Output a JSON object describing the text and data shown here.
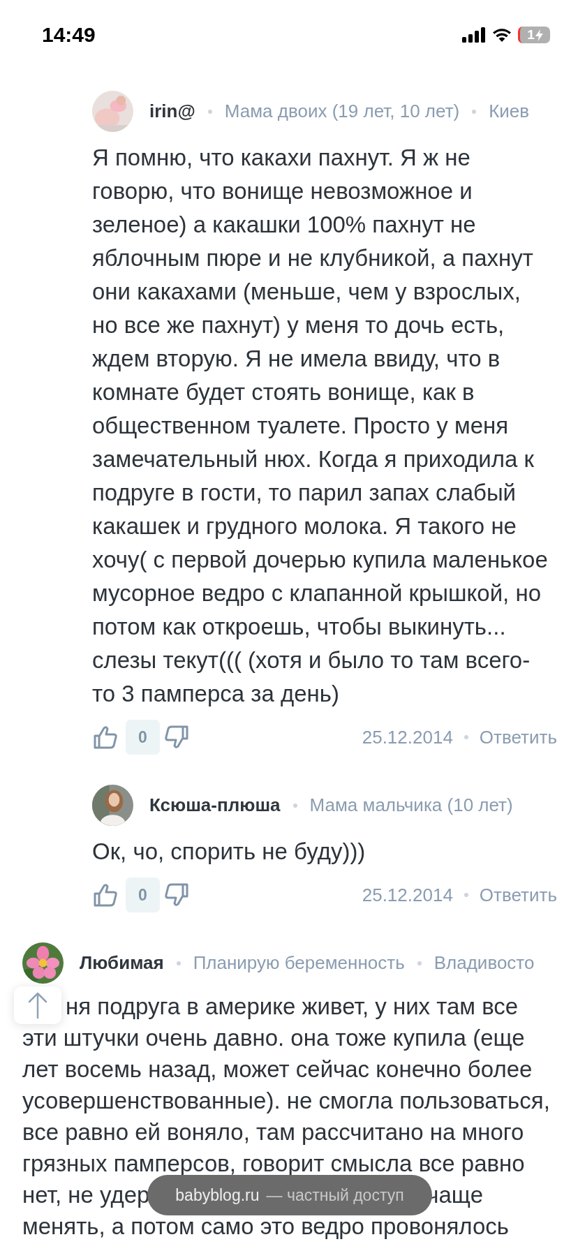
{
  "status_bar": {
    "time": "14:49",
    "battery": "1"
  },
  "comments": [
    {
      "kind": "reply",
      "author": "irin@",
      "meta": [
        "Мама двоих (19 лет, 10 лет)",
        "Киев"
      ],
      "text": "Я помню, что какахи пахнут. Я ж не говорю, что вонище невозможное и зеленое) а какашки 100% пахнут не яблочным пюре и не клубникой, а пахнут они какахами (меньше, чем у взрослых, но все же пахнут) у меня то дочь есть, ждем вторую. Я не имела ввиду, что в комнате будет стоять вонище, как в общественном туалете. Просто у меня замечательный нюх. Когда я приходила к подруге в гости, то парил запах слабый какашек и грудного молока. Я такого не хочу( с первой дочерью купила маленькое мусорное ведро с клапанной крышкой, но потом как откроешь, чтобы выкинуть... слезы текут((( (хотя и было то там всего-то 3 памперса за день)",
      "rating": "0",
      "date": "25.12.2014",
      "reply": "Ответить"
    },
    {
      "kind": "reply",
      "author": "Ксюша-плюша",
      "meta": [
        "Мама мальчика (10 лет)"
      ],
      "text": "Ок, чо, спорить не буду)))",
      "rating": "0",
      "date": "25.12.2014",
      "reply": "Ответить"
    },
    {
      "kind": "top",
      "author": "Любимая",
      "meta": [
        "Планирую беременность",
        "Владивосто"
      ],
      "lines": [
        [
          "ня подруга в америке живет, у них там все"
        ],
        [
          "эти штучки очень давно. она тоже купила (еще"
        ],
        [
          "лет восемь назад, может сейчас конечно более"
        ],
        [
          "усовершенствованные). не смогла пользоваться,"
        ],
        [
          "все равно ей воняло, там рассчитано на много"
        ],
        [
          "грязных памперсов, говорит смысла все равно"
        ],
        [
          "нет, не удер",
          "чаще"
        ],
        [
          "менять, а потом само это ведро провонялось"
        ]
      ]
    }
  ],
  "toast": {
    "site": "babyblog.ru",
    "note": "— частный доступ"
  }
}
